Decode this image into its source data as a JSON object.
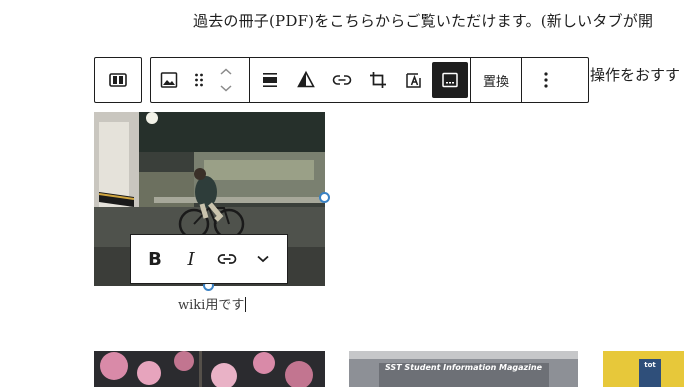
{
  "paragraph_text": "過去の冊子(PDF)をこちらからご覧いただけます。(新しいタブが開",
  "paragraph_text_2": "操作をおすす",
  "block_toolbar": {
    "replace_label": "置換",
    "buttons": [
      "block-type-icon",
      "image-icon",
      "drag-handle-icon",
      "move-up-icon",
      "move-down-icon",
      "align-icon",
      "duotone-icon",
      "link-icon",
      "crop-icon",
      "text-overlay-icon",
      "caption-icon",
      "replace-button",
      "more-options-icon"
    ]
  },
  "format_toolbar": {
    "bold_label": "B",
    "italic_label": "I"
  },
  "caption_text": "wiki用です",
  "thumbnail_2_text": "SST Student Information Magazine",
  "thumbnail_3_text": "tot",
  "colors": {
    "accent": "#3b82c4",
    "dark": "#1e1e1e"
  }
}
